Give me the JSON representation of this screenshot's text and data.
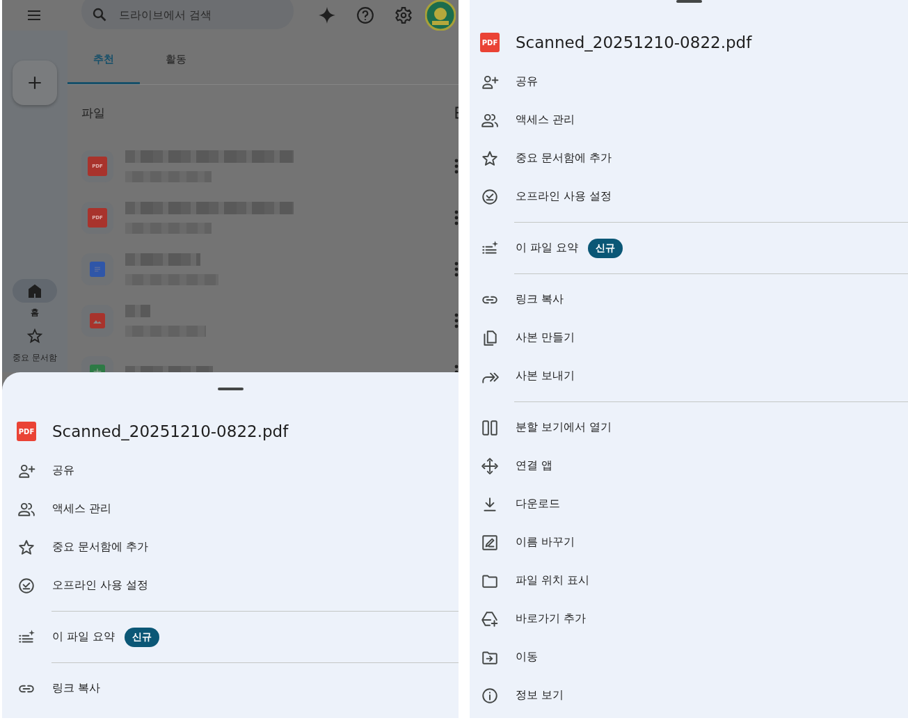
{
  "left_screen": {
    "search": {
      "placeholder": "드라이브에서 검색"
    },
    "tabs": [
      {
        "label": "추천",
        "selected": true
      },
      {
        "label": "활동",
        "selected": false
      }
    ],
    "section_title": "파일",
    "files": [
      {
        "kind": "pdf",
        "icon_text": "PDF"
      },
      {
        "kind": "pdf",
        "icon_text": "PDF"
      },
      {
        "kind": "doc"
      },
      {
        "kind": "image"
      },
      {
        "kind": "sheet"
      }
    ],
    "nav": [
      {
        "kind": "home",
        "label": "홈",
        "selected": true
      },
      {
        "kind": "star",
        "label": "중요 문서함",
        "selected": false
      }
    ],
    "sheet": {
      "file_icon_text": "PDF",
      "title": "Scanned_20251210-0822.pdf",
      "groups": [
        {
          "items": [
            {
              "kind": "share",
              "label": "공유"
            },
            {
              "kind": "access",
              "label": "액세스 관리"
            },
            {
              "kind": "star",
              "label": "중요 문서함에 추가"
            },
            {
              "kind": "offline",
              "label": "오프라인 사용 설정"
            }
          ]
        },
        {
          "items": [
            {
              "kind": "summary",
              "label": "이 파일 요약",
              "badge": "신규"
            }
          ]
        },
        {
          "items": [
            {
              "kind": "link",
              "label": "링크 복사"
            }
          ]
        }
      ]
    }
  },
  "right_screen": {
    "sheet": {
      "file_icon_text": "PDF",
      "title": "Scanned_20251210-0822.pdf",
      "groups": [
        {
          "items": [
            {
              "kind": "share",
              "label": "공유"
            },
            {
              "kind": "access",
              "label": "액세스 관리"
            },
            {
              "kind": "star",
              "label": "중요 문서함에 추가"
            },
            {
              "kind": "offline",
              "label": "오프라인 사용 설정"
            }
          ]
        },
        {
          "items": [
            {
              "kind": "summary",
              "label": "이 파일 요약",
              "badge": "신규"
            }
          ]
        },
        {
          "items": [
            {
              "kind": "link",
              "label": "링크 복사"
            },
            {
              "kind": "copy",
              "label": "사본 만들기"
            },
            {
              "kind": "send",
              "label": "사본 보내기"
            }
          ]
        },
        {
          "items": [
            {
              "kind": "split",
              "label": "분할 보기에서 열기"
            },
            {
              "kind": "apps",
              "label": "연결 앱"
            },
            {
              "kind": "download",
              "label": "다운로드"
            },
            {
              "kind": "rename",
              "label": "이름 바꾸기"
            },
            {
              "kind": "location",
              "label": "파일 위치 표시"
            },
            {
              "kind": "shortcut",
              "label": "바로가기 추가"
            },
            {
              "kind": "move",
              "label": "이동"
            },
            {
              "kind": "info",
              "label": "정보 보기"
            }
          ]
        }
      ]
    }
  }
}
